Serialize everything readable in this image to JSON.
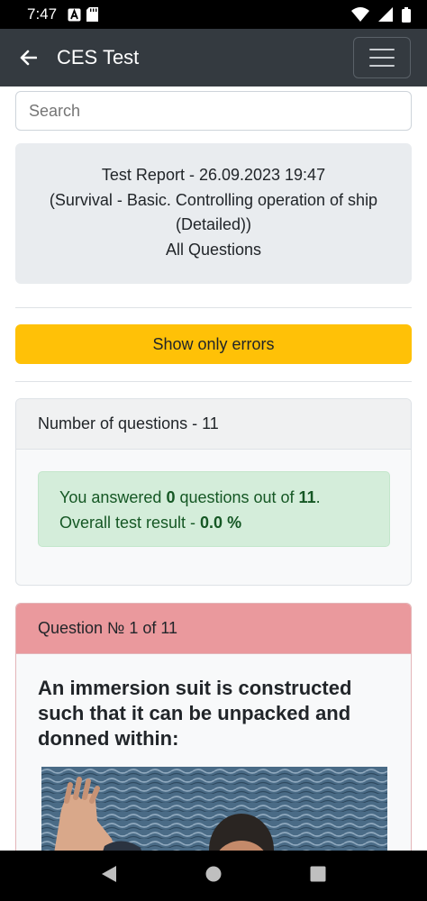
{
  "status_bar": {
    "time": "7:47",
    "left_icons": [
      "a-icon",
      "sd-card-icon"
    ],
    "right_icons": [
      "wifi-icon",
      "signal-icon",
      "battery-icon"
    ]
  },
  "app_bar": {
    "title": "CES Test",
    "back_icon": "arrow-left-icon",
    "menu_icon": "hamburger-icon",
    "background": "#343a40"
  },
  "search": {
    "placeholder": "Search"
  },
  "report": {
    "line1": "Test Report - 26.09.2023 19:47",
    "line2": "(Survival - Basic. Controlling operation of ship",
    "line3": "(Detailed))",
    "line4": "All Questions"
  },
  "errors_button": {
    "label": "Show only errors",
    "color": "#ffc107"
  },
  "summary": {
    "header": "Number of questions - 11",
    "answered_prefix": "You answered ",
    "answered_count": "0",
    "answered_middle": " questions out of ",
    "total": "11",
    "answered_suffix": ".",
    "result_prefix": "Overall test result - ",
    "result_value": "0.0 %"
  },
  "question": {
    "header": "Question № 1 of 11",
    "text": "An immersion suit is constructed such that it can be unpacked and donned within:",
    "image_icon": "person-in-water-photo",
    "header_color": "#ea999d"
  },
  "nav_bar": {
    "icons": [
      "back-triangle-icon",
      "home-circle-icon",
      "recents-square-icon"
    ]
  }
}
